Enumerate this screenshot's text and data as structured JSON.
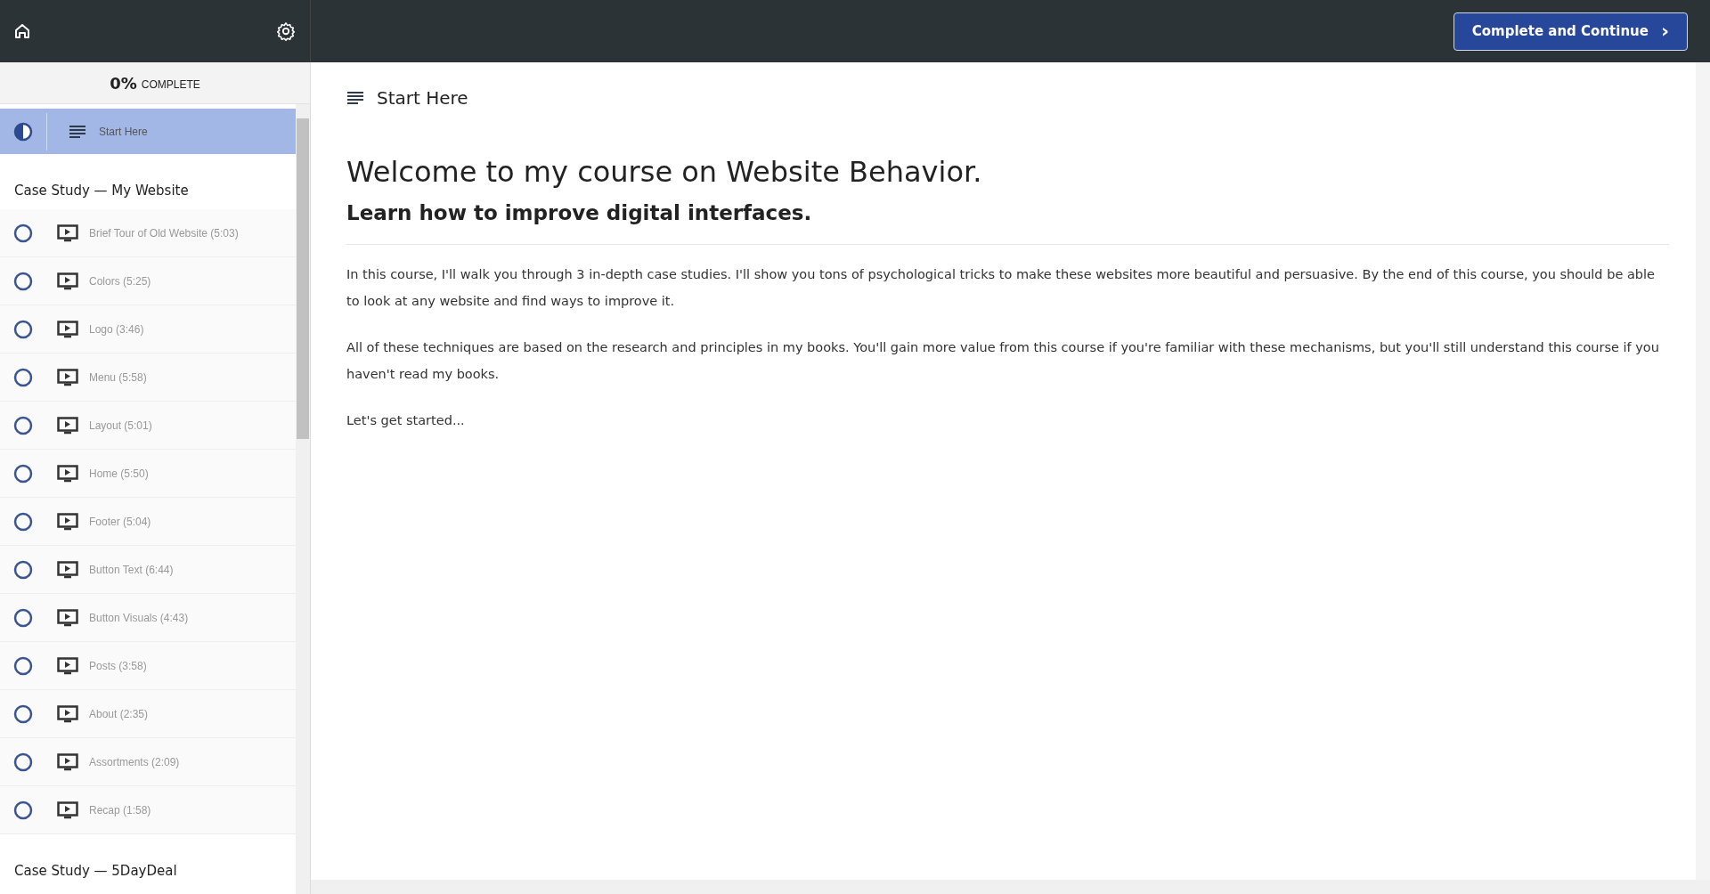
{
  "top_bar": {
    "button": "Complete and Continue",
    "button_icon": "›"
  },
  "sidebar": {
    "progress": {
      "percent": "0%",
      "label": "COMPLETE"
    },
    "sections": [
      {
        "items": [
          {
            "kind": "text",
            "title": "Start Here",
            "started": true,
            "selected": true
          }
        ]
      },
      {
        "title": "Case Study — My Website",
        "items": [
          {
            "kind": "video",
            "title": "Brief Tour of Old Website (5:03)",
            "started": false,
            "selected": false
          },
          {
            "kind": "video",
            "title": "Colors (5:25)",
            "started": false,
            "selected": false
          },
          {
            "kind": "video",
            "title": "Logo (3:46)",
            "started": false,
            "selected": false
          },
          {
            "kind": "video",
            "title": "Menu (5:58)",
            "started": false,
            "selected": false
          },
          {
            "kind": "video",
            "title": "Layout (5:01)",
            "started": false,
            "selected": false
          },
          {
            "kind": "video",
            "title": "Home (5:50)",
            "started": false,
            "selected": false
          },
          {
            "kind": "video",
            "title": "Footer (5:04)",
            "started": false,
            "selected": false
          },
          {
            "kind": "video",
            "title": "Button Text (6:44)",
            "started": false,
            "selected": false
          },
          {
            "kind": "video",
            "title": "Button Visuals (4:43)",
            "started": false,
            "selected": false
          },
          {
            "kind": "video",
            "title": "Posts (3:58)",
            "started": false,
            "selected": false
          },
          {
            "kind": "video",
            "title": "About (2:35)",
            "started": false,
            "selected": false
          },
          {
            "kind": "video",
            "title": "Assortments (2:09)",
            "started": false,
            "selected": false
          },
          {
            "kind": "video",
            "title": "Recap (1:58)",
            "started": false,
            "selected": false
          }
        ]
      },
      {
        "title": "Case Study — 5DayDeal"
      }
    ]
  },
  "lecture": {
    "title": "Start Here",
    "heading": "Welcome to my course on Website Behavior.",
    "subheading": "Learn how to improve digital interfaces.",
    "paragraphs": [
      "In this course, I'll walk you through 3 in-depth case studies. I'll show you tons of psychological tricks to make these websites more beautiful and persuasive. By the end of this course, you should be able to look at any website and find ways to improve it.",
      "All of these techniques are based on the research and principles in my books. You'll gain more value from this course if you're familiar with these mechanisms, but you'll still understand this course if you haven't read my books.",
      "Let's get started..."
    ]
  }
}
